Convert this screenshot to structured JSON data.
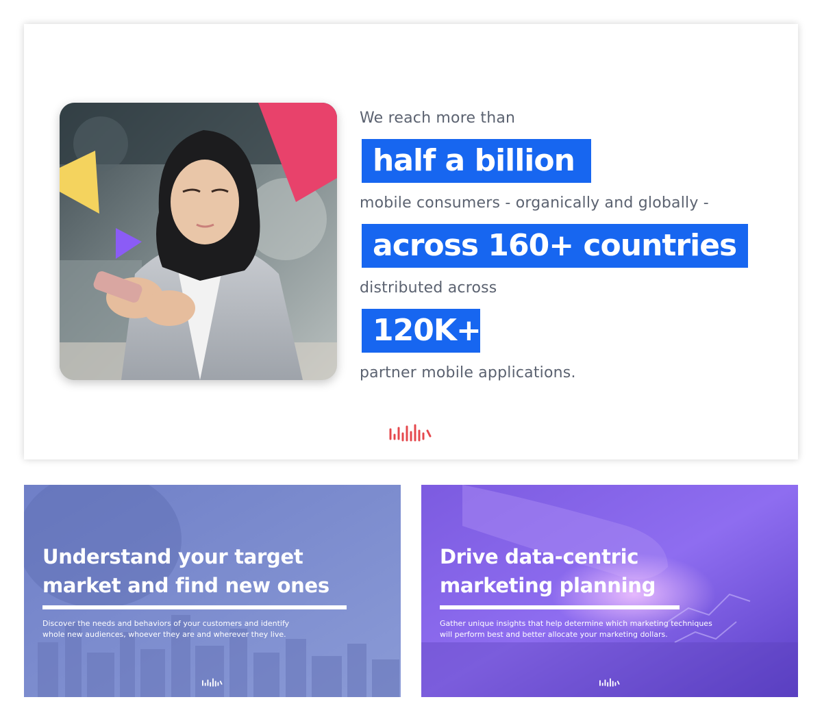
{
  "colors": {
    "highlight": "#1766f0",
    "brand_red": "#e5484d",
    "triangle_pink": "#e8426b",
    "triangle_yellow": "#f4d35e",
    "triangle_purple": "#8b5cf6"
  },
  "hero": {
    "photo_icon": "woman-using-phone-photo",
    "line1": "We reach more than",
    "highlight1": "half a billion",
    "line2": "mobile consumers - organically and globally -",
    "highlight2": "across 160+ countries",
    "line3": "distributed across",
    "highlight3": "120K+",
    "line4": "partner mobile applications.",
    "logo_icon": "brand-waveform-logo"
  },
  "cards": [
    {
      "title": "Understand your target\nmarket and find new ones",
      "description": "Discover the needs and behaviors of your customers and identify\nwhole new audiences, whoever they are and wherever they live.",
      "logo_icon": "brand-waveform-logo"
    },
    {
      "title": "Drive data-centric\nmarketing planning",
      "description": "Gather unique insights that help determine which marketing techniques\nwill perform best and better allocate your marketing dollars.",
      "logo_icon": "brand-waveform-logo"
    }
  ]
}
